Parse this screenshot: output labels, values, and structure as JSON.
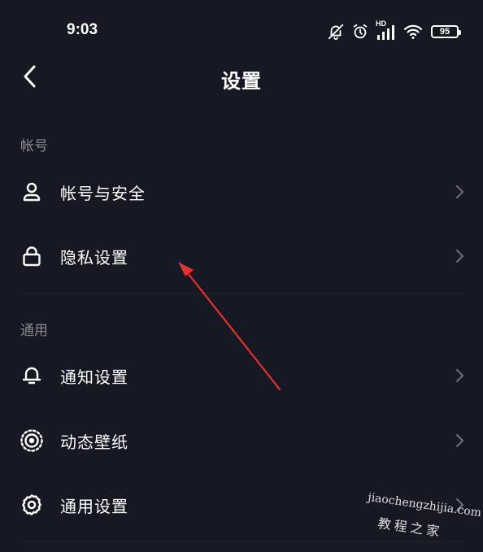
{
  "status_bar": {
    "time": "9:03",
    "network_label": "HD",
    "battery_level": "95",
    "icons": [
      "mute-bell-icon",
      "alarm-icon",
      "signal-icon",
      "wifi-icon",
      "battery-icon"
    ]
  },
  "header": {
    "title": "设置",
    "back_icon": "chevron-left-icon"
  },
  "sections": [
    {
      "label": "帐号",
      "items": [
        {
          "label": "帐号与安全",
          "icon": "user-icon"
        },
        {
          "label": "隐私设置",
          "icon": "lock-icon"
        }
      ]
    },
    {
      "label": "通用",
      "items": [
        {
          "label": "通知设置",
          "icon": "bell-icon"
        },
        {
          "label": "动态壁纸",
          "icon": "live-wallpaper-icon"
        },
        {
          "label": "通用设置",
          "icon": "gear-icon"
        }
      ]
    }
  ],
  "annotation": {
    "arrow_color": "#e8302c"
  },
  "watermark": {
    "latin": "jiaochengzhijia.com",
    "cn": "教程之家"
  },
  "colors": {
    "background": "#161823",
    "text": "#ffffff",
    "section_label": "#8a8b91",
    "chevron": "#6b6c73",
    "divider": "#24262f"
  }
}
